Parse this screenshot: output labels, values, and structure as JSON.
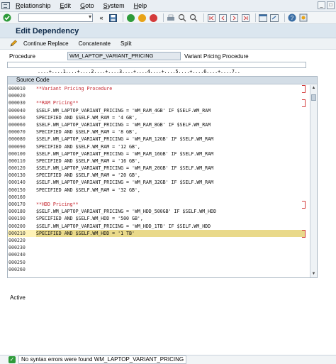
{
  "menu": {
    "items": [
      "Relationship",
      "Edit",
      "Goto",
      "System",
      "Help"
    ],
    "underlined_keys": [
      "R",
      "E",
      "G",
      "S",
      "H"
    ]
  },
  "screen": {
    "title": "Edit Dependency"
  },
  "app_toolbar": {
    "continue_replace": "Continue Replace",
    "concatenate": "Concatenate",
    "split": "Split"
  },
  "procedure": {
    "label": "Procedure",
    "value": "WM_LAPTOP_VARIANT_PRICING",
    "description": "Variant Pricing Procedure"
  },
  "ruler": "....+....1....+....2....+....3....+....4....+....5....+....6....+....7..",
  "editor": {
    "header": "Source Code",
    "lines": [
      {
        "n": "000010",
        "code": "**Variant Pricing Procedure",
        "comment": true
      },
      {
        "n": "000020",
        "code": "",
        "comment": false
      },
      {
        "n": "000030",
        "code": "**RAM Pricing**",
        "comment": true
      },
      {
        "n": "000040",
        "code": "$SELF.WM_LAPTOP_VARIANT_PRICING = 'WM_RAM_4GB' IF $SELF.WM_RAM",
        "comment": false
      },
      {
        "n": "000050",
        "code": "SPECIFIED AND $SELF.WM_RAM = '4 GB',",
        "comment": false
      },
      {
        "n": "000060",
        "code": "$SELF.WM_LAPTOP_VARIANT_PRICING = 'WM_RAM_8GB' IF $SELF.WM_RAM",
        "comment": false
      },
      {
        "n": "000070",
        "code": "SPECIFIED AND $SELF.WM_RAM = '8 GB',",
        "comment": false
      },
      {
        "n": "000080",
        "code": "$SELF.WM_LAPTOP_VARIANT_PRICING = 'WM_RAM_12GB' IF $SELF.WM_RAM",
        "comment": false
      },
      {
        "n": "000090",
        "code": "SPECIFIED AND $SELF.WM_RAM = '12 GB',",
        "comment": false
      },
      {
        "n": "000100",
        "code": "$SELF.WM_LAPTOP_VARIANT_PRICING = 'WM_RAM_16GB' IF $SELF.WM_RAM",
        "comment": false
      },
      {
        "n": "000110",
        "code": "SPECIFIED AND $SELF.WM_RAM = '16 GB',",
        "comment": false
      },
      {
        "n": "000120",
        "code": "$SELF.WM_LAPTOP_VARIANT_PRICING = 'WM_RAM_20GB' IF $SELF.WM_RAM",
        "comment": false
      },
      {
        "n": "000130",
        "code": "SPECIFIED AND $SELF.WM_RAM = '20 GB',",
        "comment": false
      },
      {
        "n": "000140",
        "code": "$SELF.WM_LAPTOP_VARIANT_PRICING = 'WM_RAM_32GB' IF $SELF.WM_RAM",
        "comment": false
      },
      {
        "n": "000150",
        "code": "SPECIFIED AND $SELF.WM_RAM = '32 GB',",
        "comment": false
      },
      {
        "n": "000160",
        "code": "",
        "comment": false
      },
      {
        "n": "000170",
        "code": "**HDD Pricing**",
        "comment": true
      },
      {
        "n": "000180",
        "code": "$SELF.WM_LAPTOP_VARIANT_PRICING = 'WM_HDD_500GB' IF $SELF.WM_HDD",
        "comment": false
      },
      {
        "n": "000190",
        "code": "SPECIFIED AND $SELF.WM_HDD = '500 GB',",
        "comment": false
      },
      {
        "n": "000200",
        "code": "$SELF.WM_LAPTOP_VARIANT_PRICING = 'WM_HDD_1TB' IF $SELF.WM_HDD",
        "comment": false
      },
      {
        "n": "000210",
        "code": "SPECIFIED AND $SELF.WM_HDD = '1 TB'",
        "comment": false,
        "active": true
      },
      {
        "n": "000220",
        "code": "",
        "comment": false
      },
      {
        "n": "000230",
        "code": "",
        "comment": false
      },
      {
        "n": "000240",
        "code": "",
        "comment": false
      },
      {
        "n": "000250",
        "code": "",
        "comment": false
      },
      {
        "n": "000260",
        "code": "",
        "comment": false
      }
    ]
  },
  "status": {
    "state": "Active",
    "message": "No syntax errors were found WM_LAPTOP_VARIANT_PRICING"
  },
  "colors": {
    "comment": "#c4222b",
    "active_line": "#fff3b8",
    "title_bg": "#dbe6ef",
    "success": "#2e9b3a"
  }
}
